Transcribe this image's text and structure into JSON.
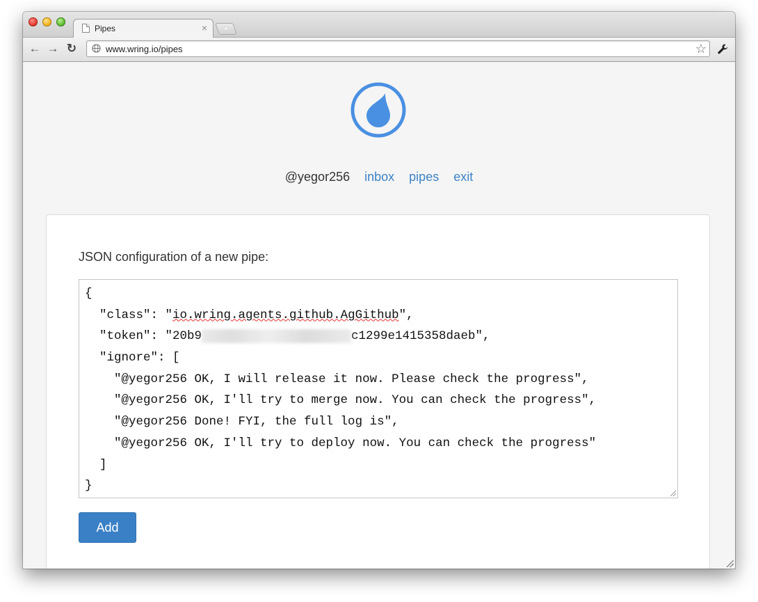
{
  "browser": {
    "tab_title": "Pipes",
    "tab_close": "×",
    "new_tab": "+",
    "url": "www.wring.io/pipes",
    "star": "☆"
  },
  "nav": {
    "user": "@yegor256",
    "links": [
      "inbox",
      "pipes",
      "exit"
    ]
  },
  "form": {
    "label": "JSON configuration of a new pipe:",
    "code": {
      "open_brace": "{",
      "class_prefix": "  \"class\": \"",
      "class_value": "io.wring.agents.github.AgGithub",
      "class_suffix": "\",",
      "token_prefix": "  \"token\": \"20b9",
      "token_suffix": "c1299e1415358daeb\",",
      "ignore_open": "  \"ignore\": [",
      "ignore_items": [
        "    \"@yegor256 OK, I will release it now. Please check the progress\",",
        "    \"@yegor256 OK, I'll try to merge now. You can check the progress\",",
        "    \"@yegor256 Done! FYI, the full log is\",",
        "    \"@yegor256 OK, I'll try to deploy now. You can check the progress\""
      ],
      "ignore_close": "  ]",
      "close_brace": "}"
    },
    "button": "Add"
  },
  "colors": {
    "accent": "#3a80c6",
    "link": "#3e83c7",
    "logo": "#4a90e2"
  }
}
